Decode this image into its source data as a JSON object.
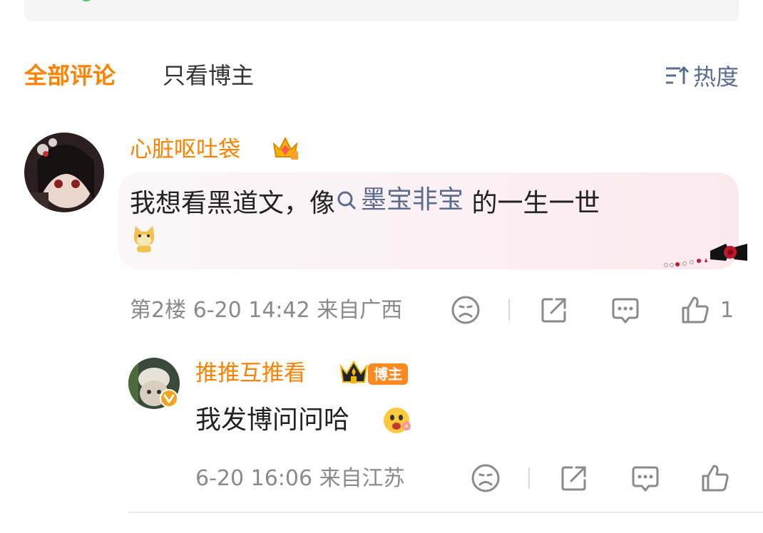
{
  "tabs": {
    "all_comments": "全部评论",
    "blogger_only": "只看博主",
    "sort_label": "热度"
  },
  "comment": {
    "username": "心脏呕吐袋",
    "text_before": "我想看黑道文，像",
    "topic": "墨宝非宝",
    "text_after": "的一生一世",
    "floor": "第2楼",
    "time": "6-20 14:42",
    "location": "来自广西",
    "likes": "1"
  },
  "reply": {
    "username": "推推互推看",
    "badge": "博主",
    "text": "我发博问问哈",
    "time": "6-20 16:06",
    "location": "来自江苏"
  },
  "colors": {
    "accent": "#ff8200",
    "link": "#5a6d8c",
    "meta": "#8a8a8a"
  },
  "icons": [
    "sort-icon",
    "search-icon",
    "dislike-icon",
    "share-icon",
    "comment-icon",
    "like-icon",
    "vip-crown-icon",
    "verified-icon"
  ]
}
